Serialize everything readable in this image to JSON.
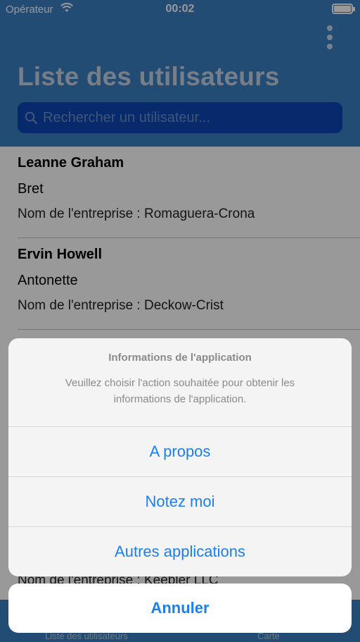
{
  "status_bar": {
    "carrier": "Opérateur",
    "time": "00:02"
  },
  "header": {
    "title": "Liste des utilisateurs"
  },
  "search": {
    "placeholder": "Rechercher un utilisateur..."
  },
  "users": [
    {
      "name": "Leanne Graham",
      "username": "Bret",
      "company": "Nom de l'entreprise : Romaguera-Crona"
    },
    {
      "name": "Ervin Howell",
      "username": "Antonette",
      "company": "Nom de l'entreprise : Deckow-Crist"
    },
    {
      "name": "",
      "username": "",
      "company": "Nom de l'entreprise : Keebler LLC"
    }
  ],
  "tabbar": {
    "tab1": "Liste des utilisateurs",
    "tab2": "Carte"
  },
  "action_sheet": {
    "title": "Informations de l'application",
    "message": "Veuillez choisir l'action souhaitée pour obtenir les informations de l'application.",
    "actions": [
      "A propos",
      "Notez moi",
      "Autres applications"
    ],
    "cancel": "Annuler"
  },
  "colors": {
    "header": "#3b7fc1",
    "accent": "#1b7ff0",
    "search_bg": "#0a47b3"
  }
}
